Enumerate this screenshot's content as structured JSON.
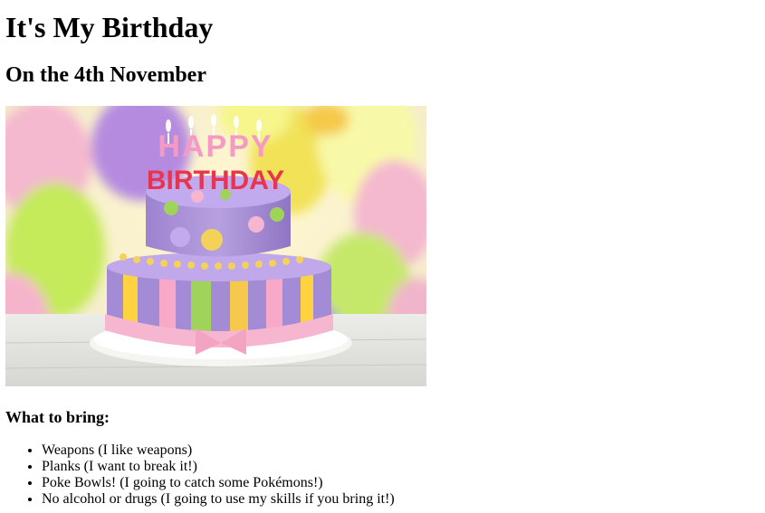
{
  "page": {
    "title": "It's My Birthday",
    "subtitle": "On the 4th November",
    "image": {
      "icon": "birthday-cake-photo",
      "cake_text_line1": "HAPPY",
      "cake_text_line2": "BIRTHDAY"
    },
    "bring_heading": "What to bring:",
    "bring_items": [
      "Weapons (I like weapons)",
      "Planks (I want to break it!)",
      "Poke Bowls! (I going to catch some Pokémons!)",
      "No alcohol or drugs (I going to use my skills if you bring it!)"
    ]
  }
}
